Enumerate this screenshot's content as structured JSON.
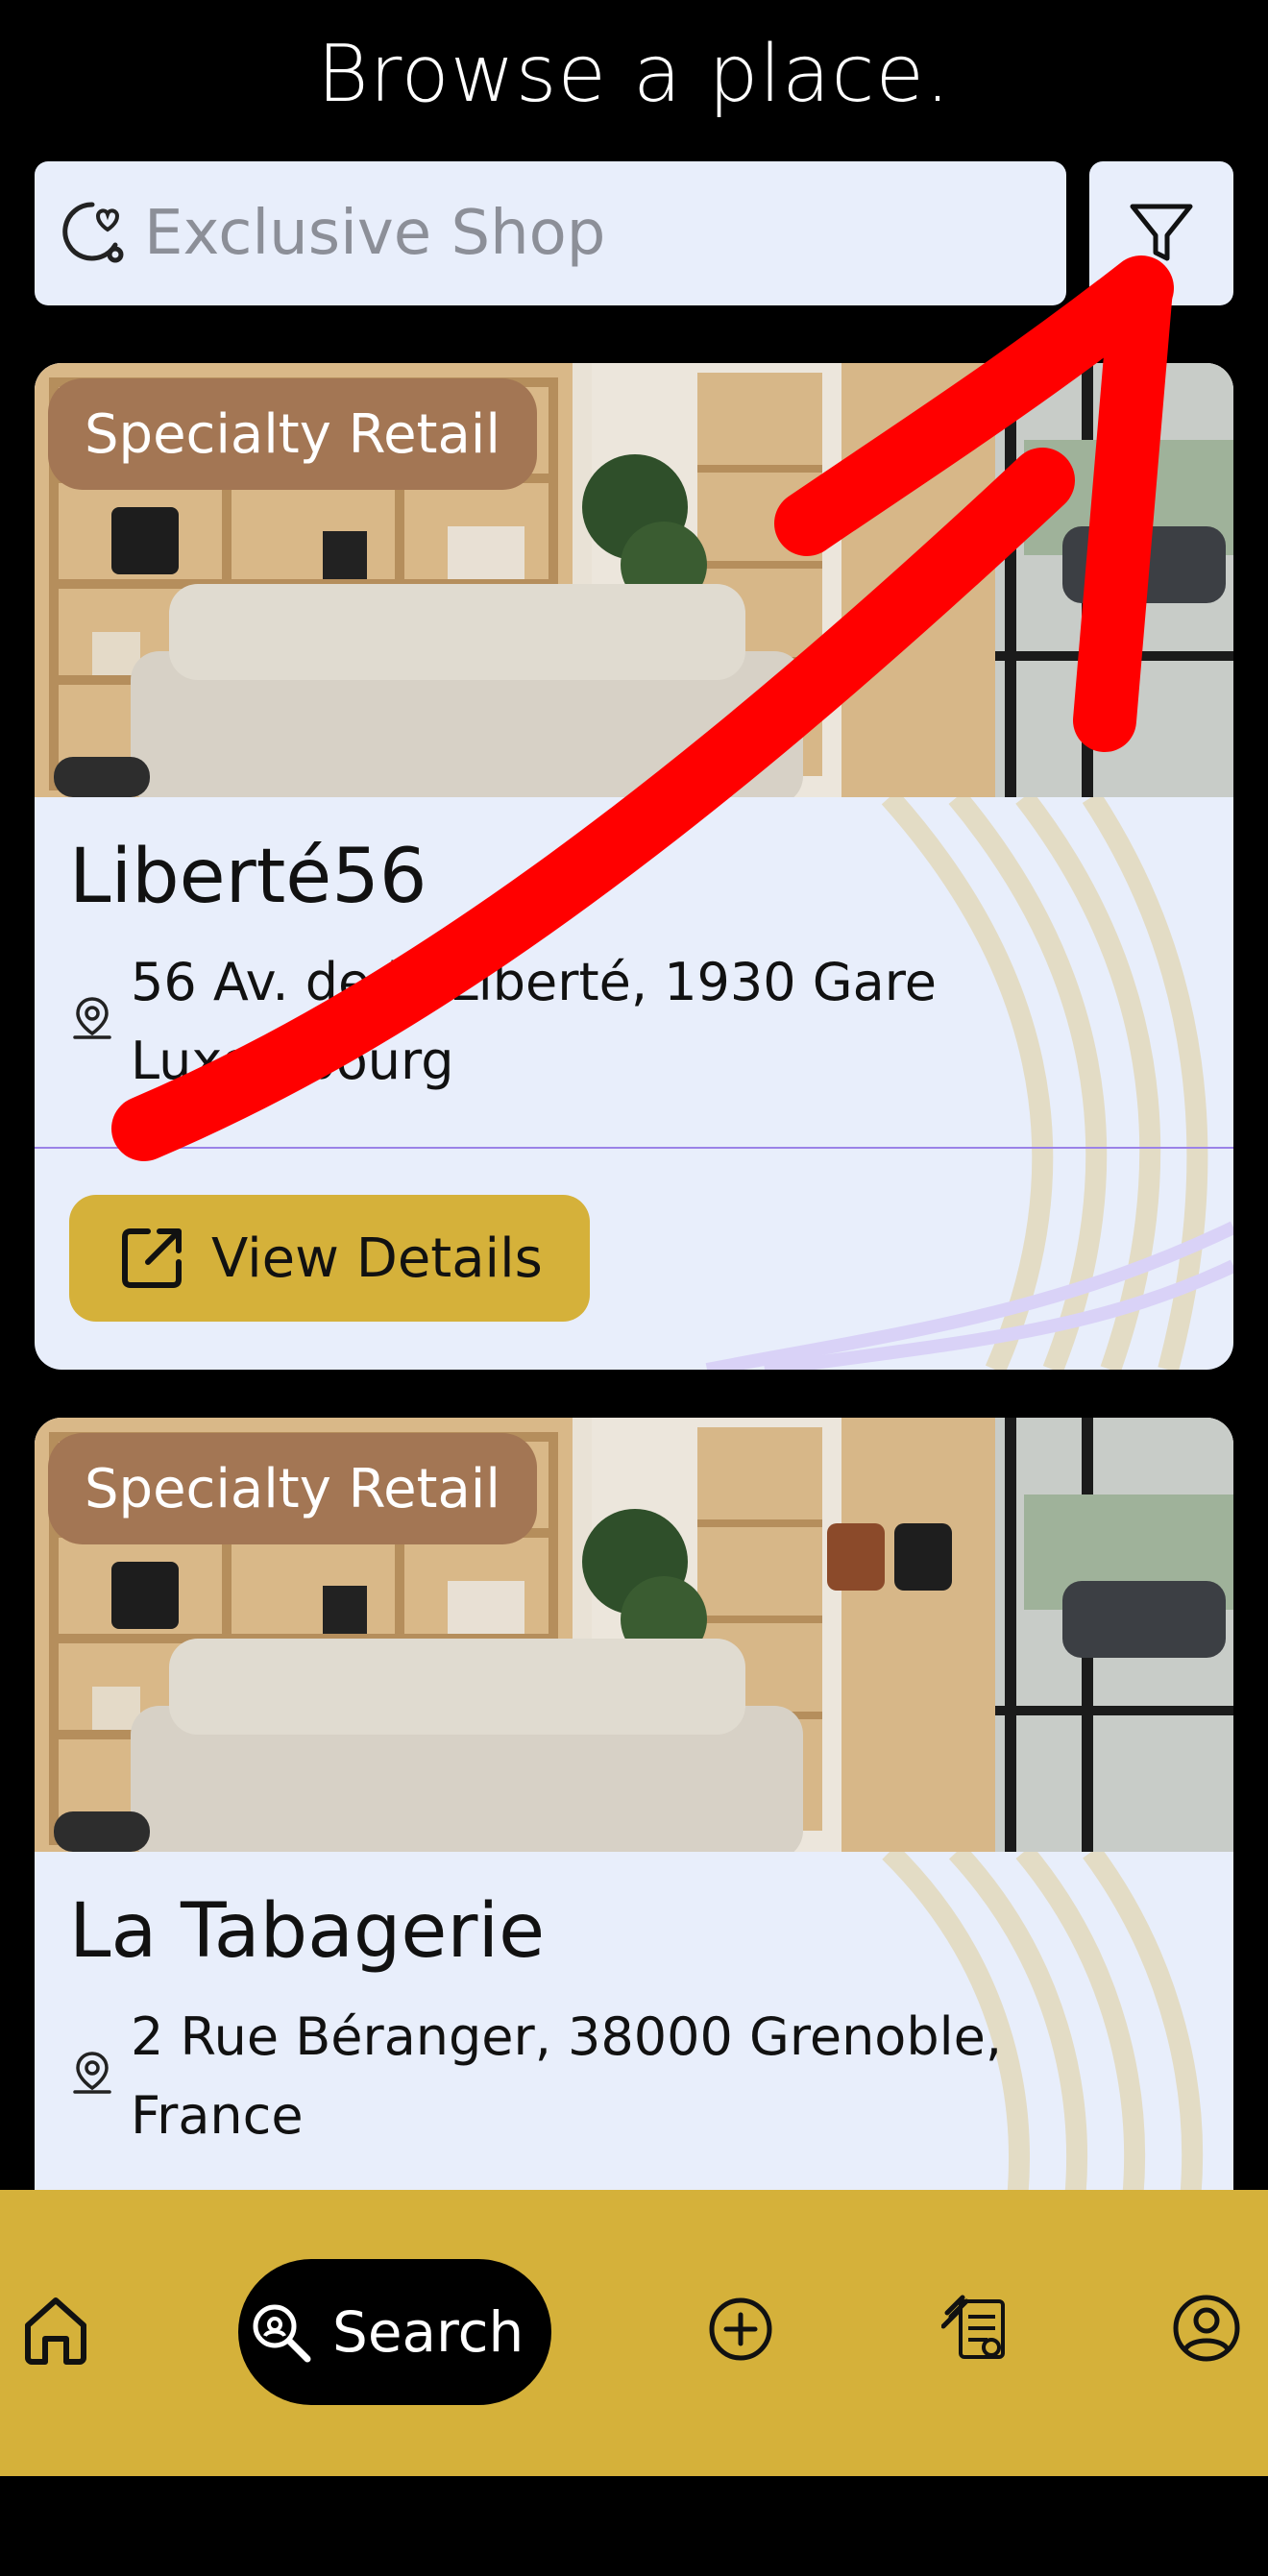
{
  "header": {
    "title": "Browse a place."
  },
  "search": {
    "placeholder": "Exclusive Shop",
    "value": ""
  },
  "filter": {
    "icon": "filter-icon"
  },
  "places": [
    {
      "category": "Specialty Retail",
      "name": "Liberté56",
      "address": "56 Av. de la Liberté, 1930 Gare Luxembourg",
      "action_label": "View Details"
    },
    {
      "category": "Specialty Retail",
      "name": "La Tabagerie",
      "address": "2 Rue Béranger, 38000 Grenoble, France"
    }
  ],
  "bottom_nav": {
    "items": [
      {
        "icon": "home-icon"
      },
      {
        "icon": "search-icon",
        "label": "Search",
        "active": true
      },
      {
        "icon": "add-circle-icon"
      },
      {
        "icon": "documents-icon"
      },
      {
        "icon": "profile-icon"
      }
    ]
  },
  "colors": {
    "background": "#000000",
    "card": "#e8eefb",
    "badge": "#a37654",
    "accent": "#d5b13a",
    "annotation_arrow": "#ff0000"
  }
}
